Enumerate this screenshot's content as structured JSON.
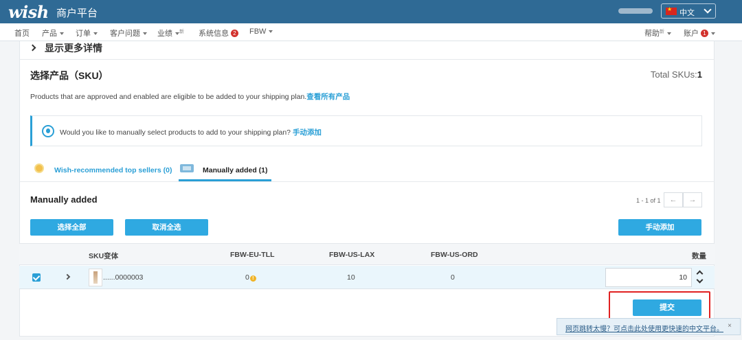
{
  "header": {
    "logo": "wish",
    "platform": "商户平台",
    "language": "中文"
  },
  "nav": {
    "items": [
      "首页",
      "产品",
      "订单",
      "客户问题",
      "业绩",
      "系统信息",
      "FBW"
    ],
    "new_sup": "新",
    "sys_badge": "2",
    "help": "帮助",
    "help_sup": "新",
    "account": "账户",
    "account_badge": "1"
  },
  "more_details": "显示更多详情",
  "select_section": {
    "title": "选择产品（SKU）",
    "total_label": "Total SKUs:",
    "total_value": "1",
    "desc": "Products that are approved and enabled are eligible to be added to your shipping plan.",
    "view_all_link": "查看所有产品",
    "info_text": "Would you like to manually select products to add to your shipping plan?",
    "manual_link": "手动添加"
  },
  "tabs": [
    {
      "label": "Wish-recommended top sellers (0)"
    },
    {
      "label": "Manually added (1)"
    }
  ],
  "manual": {
    "title": "Manually added",
    "pager": "1 - 1 of 1",
    "prev": "←",
    "next": "→",
    "select_all": "选择全部",
    "deselect_all": "取消全选",
    "manual_add": "手动添加"
  },
  "table": {
    "headers": [
      "SKU变体",
      "FBW-EU-TLL",
      "FBW-US-LAX",
      "FBW-US-ORD",
      "数量"
    ],
    "rows": [
      {
        "sku": "......0000003",
        "eu_tll": "0",
        "us_lax": "10",
        "us_ord": "0",
        "qty": "10"
      }
    ]
  },
  "submit": "提交",
  "toast": {
    "text": "网页跳转太慢？可点击此处使用更快速的中文平台。",
    "close": "×"
  }
}
